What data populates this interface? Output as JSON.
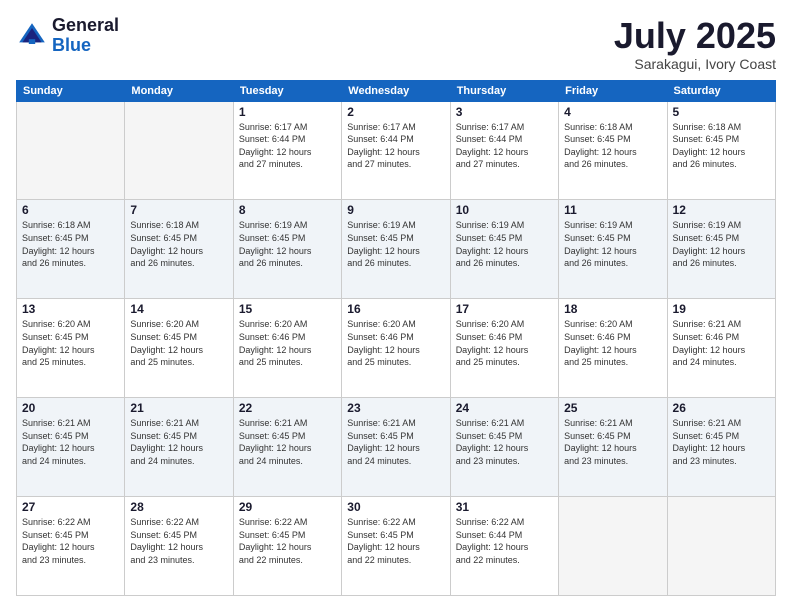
{
  "header": {
    "logo_general": "General",
    "logo_blue": "Blue",
    "month": "July 2025",
    "location": "Sarakagui, Ivory Coast"
  },
  "weekdays": [
    "Sunday",
    "Monday",
    "Tuesday",
    "Wednesday",
    "Thursday",
    "Friday",
    "Saturday"
  ],
  "weeks": [
    [
      {
        "day": "",
        "info": ""
      },
      {
        "day": "",
        "info": ""
      },
      {
        "day": "1",
        "info": "Sunrise: 6:17 AM\nSunset: 6:44 PM\nDaylight: 12 hours\nand 27 minutes."
      },
      {
        "day": "2",
        "info": "Sunrise: 6:17 AM\nSunset: 6:44 PM\nDaylight: 12 hours\nand 27 minutes."
      },
      {
        "day": "3",
        "info": "Sunrise: 6:17 AM\nSunset: 6:44 PM\nDaylight: 12 hours\nand 27 minutes."
      },
      {
        "day": "4",
        "info": "Sunrise: 6:18 AM\nSunset: 6:45 PM\nDaylight: 12 hours\nand 26 minutes."
      },
      {
        "day": "5",
        "info": "Sunrise: 6:18 AM\nSunset: 6:45 PM\nDaylight: 12 hours\nand 26 minutes."
      }
    ],
    [
      {
        "day": "6",
        "info": "Sunrise: 6:18 AM\nSunset: 6:45 PM\nDaylight: 12 hours\nand 26 minutes."
      },
      {
        "day": "7",
        "info": "Sunrise: 6:18 AM\nSunset: 6:45 PM\nDaylight: 12 hours\nand 26 minutes."
      },
      {
        "day": "8",
        "info": "Sunrise: 6:19 AM\nSunset: 6:45 PM\nDaylight: 12 hours\nand 26 minutes."
      },
      {
        "day": "9",
        "info": "Sunrise: 6:19 AM\nSunset: 6:45 PM\nDaylight: 12 hours\nand 26 minutes."
      },
      {
        "day": "10",
        "info": "Sunrise: 6:19 AM\nSunset: 6:45 PM\nDaylight: 12 hours\nand 26 minutes."
      },
      {
        "day": "11",
        "info": "Sunrise: 6:19 AM\nSunset: 6:45 PM\nDaylight: 12 hours\nand 26 minutes."
      },
      {
        "day": "12",
        "info": "Sunrise: 6:19 AM\nSunset: 6:45 PM\nDaylight: 12 hours\nand 26 minutes."
      }
    ],
    [
      {
        "day": "13",
        "info": "Sunrise: 6:20 AM\nSunset: 6:45 PM\nDaylight: 12 hours\nand 25 minutes."
      },
      {
        "day": "14",
        "info": "Sunrise: 6:20 AM\nSunset: 6:45 PM\nDaylight: 12 hours\nand 25 minutes."
      },
      {
        "day": "15",
        "info": "Sunrise: 6:20 AM\nSunset: 6:46 PM\nDaylight: 12 hours\nand 25 minutes."
      },
      {
        "day": "16",
        "info": "Sunrise: 6:20 AM\nSunset: 6:46 PM\nDaylight: 12 hours\nand 25 minutes."
      },
      {
        "day": "17",
        "info": "Sunrise: 6:20 AM\nSunset: 6:46 PM\nDaylight: 12 hours\nand 25 minutes."
      },
      {
        "day": "18",
        "info": "Sunrise: 6:20 AM\nSunset: 6:46 PM\nDaylight: 12 hours\nand 25 minutes."
      },
      {
        "day": "19",
        "info": "Sunrise: 6:21 AM\nSunset: 6:46 PM\nDaylight: 12 hours\nand 24 minutes."
      }
    ],
    [
      {
        "day": "20",
        "info": "Sunrise: 6:21 AM\nSunset: 6:45 PM\nDaylight: 12 hours\nand 24 minutes."
      },
      {
        "day": "21",
        "info": "Sunrise: 6:21 AM\nSunset: 6:45 PM\nDaylight: 12 hours\nand 24 minutes."
      },
      {
        "day": "22",
        "info": "Sunrise: 6:21 AM\nSunset: 6:45 PM\nDaylight: 12 hours\nand 24 minutes."
      },
      {
        "day": "23",
        "info": "Sunrise: 6:21 AM\nSunset: 6:45 PM\nDaylight: 12 hours\nand 24 minutes."
      },
      {
        "day": "24",
        "info": "Sunrise: 6:21 AM\nSunset: 6:45 PM\nDaylight: 12 hours\nand 23 minutes."
      },
      {
        "day": "25",
        "info": "Sunrise: 6:21 AM\nSunset: 6:45 PM\nDaylight: 12 hours\nand 23 minutes."
      },
      {
        "day": "26",
        "info": "Sunrise: 6:21 AM\nSunset: 6:45 PM\nDaylight: 12 hours\nand 23 minutes."
      }
    ],
    [
      {
        "day": "27",
        "info": "Sunrise: 6:22 AM\nSunset: 6:45 PM\nDaylight: 12 hours\nand 23 minutes."
      },
      {
        "day": "28",
        "info": "Sunrise: 6:22 AM\nSunset: 6:45 PM\nDaylight: 12 hours\nand 23 minutes."
      },
      {
        "day": "29",
        "info": "Sunrise: 6:22 AM\nSunset: 6:45 PM\nDaylight: 12 hours\nand 22 minutes."
      },
      {
        "day": "30",
        "info": "Sunrise: 6:22 AM\nSunset: 6:45 PM\nDaylight: 12 hours\nand 22 minutes."
      },
      {
        "day": "31",
        "info": "Sunrise: 6:22 AM\nSunset: 6:44 PM\nDaylight: 12 hours\nand 22 minutes."
      },
      {
        "day": "",
        "info": ""
      },
      {
        "day": "",
        "info": ""
      }
    ]
  ]
}
